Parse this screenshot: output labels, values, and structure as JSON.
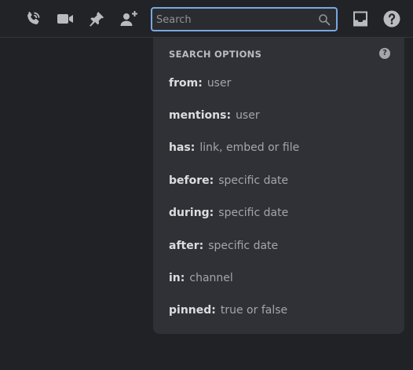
{
  "toolbar": {
    "icons": [
      "phone-call-icon",
      "video-camera-icon",
      "pin-icon",
      "add-member-icon",
      "inbox-icon",
      "help-icon"
    ],
    "search_placeholder": "Search",
    "search_value": ""
  },
  "search_options": {
    "title": "SEARCH OPTIONS",
    "help_glyph": "?",
    "options": [
      {
        "key": "from:",
        "hint": "user"
      },
      {
        "key": "mentions:",
        "hint": "user"
      },
      {
        "key": "has:",
        "hint": "link, embed or file"
      },
      {
        "key": "before:",
        "hint": "specific date"
      },
      {
        "key": "during:",
        "hint": "specific date"
      },
      {
        "key": "after:",
        "hint": "specific date"
      },
      {
        "key": "in:",
        "hint": "channel"
      },
      {
        "key": "pinned:",
        "hint": "true or false"
      }
    ]
  },
  "colors": {
    "background": "#202225",
    "panel": "#2f3136",
    "search_focus_border": "#79a7e3",
    "icon": "#b9bbbe"
  }
}
